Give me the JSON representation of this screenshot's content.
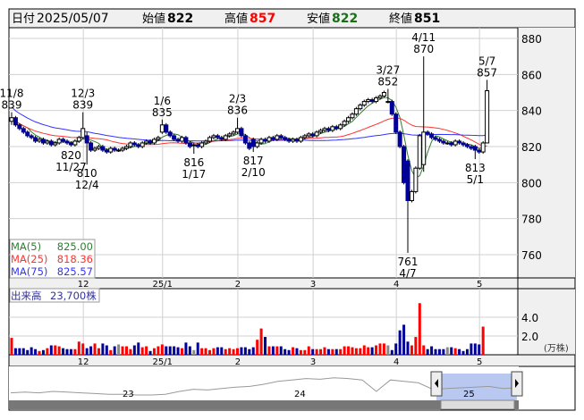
{
  "header": {
    "date_label": "日付",
    "date": "2025/05/07",
    "open_label": "始値",
    "open": "822",
    "high_label": "高値",
    "high": "857",
    "low_label": "安値",
    "low": "822",
    "close_label": "終値",
    "close": "851"
  },
  "legend": {
    "ma5_label": "MA(5)",
    "ma5": "825.00",
    "ma25_label": "MA(25)",
    "ma25": "818.36",
    "ma75_label": "MA(75)",
    "ma75": "825.57"
  },
  "volume_legend": {
    "label": "出来高",
    "value": "23,700株"
  },
  "colors": {
    "up": "#ff0000",
    "down": "#000099",
    "flat": "#888888",
    "ma5": "#2e7d32",
    "ma25": "#ff3333",
    "ma75": "#3333ff"
  },
  "chart_data": {
    "type": "candlestick",
    "price_axis": {
      "ticks": [
        "880",
        "860",
        "840",
        "820",
        "800",
        "780",
        "760"
      ],
      "ylim": [
        752,
        884
      ]
    },
    "volume_axis": {
      "ticks": [
        "4.0",
        "2.0"
      ],
      "unit": "(万株)",
      "ylim": [
        0,
        6.5
      ]
    },
    "month_labels": [
      {
        "label": "12",
        "index": 19
      },
      {
        "label": "25/1",
        "index": 39
      },
      {
        "label": "2",
        "index": 58
      },
      {
        "label": "3",
        "index": 77
      },
      {
        "label": "4",
        "index": 98
      },
      {
        "label": "5",
        "index": 119
      }
    ],
    "closes": [
      836,
      832,
      830,
      828,
      826,
      825,
      823,
      824,
      822,
      823,
      821,
      822,
      824,
      823,
      822,
      821,
      823,
      825,
      830,
      822,
      818,
      819,
      820,
      818,
      817,
      819,
      818,
      818,
      819,
      820,
      822,
      821,
      820,
      822,
      823,
      822,
      824,
      825,
      832,
      828,
      826,
      824,
      823,
      825,
      822,
      820,
      821,
      820,
      822,
      823,
      825,
      826,
      825,
      824,
      826,
      827,
      828,
      830,
      826,
      822,
      819,
      820,
      822,
      824,
      823,
      825,
      824,
      826,
      825,
      824,
      823,
      824,
      823,
      825,
      826,
      827,
      826,
      828,
      829,
      830,
      829,
      831,
      830,
      832,
      834,
      836,
      838,
      841,
      843,
      845,
      846,
      845,
      847,
      848,
      850,
      845,
      838,
      828,
      820,
      800,
      790,
      795,
      808,
      826,
      828,
      827,
      825,
      824,
      823,
      822,
      822,
      821,
      823,
      822,
      821,
      820,
      819,
      818,
      817,
      822,
      851
    ],
    "overrides": [
      {
        "index": 0,
        "open": 834,
        "high": 839,
        "low": 832
      },
      {
        "index": 18,
        "open": 825,
        "high": 839,
        "low": 824
      },
      {
        "index": 19,
        "open": 826,
        "high": 828,
        "low": 810
      },
      {
        "index": 38,
        "open": 828,
        "high": 835,
        "low": 827
      },
      {
        "index": 46,
        "open": 821,
        "high": 822,
        "low": 816
      },
      {
        "index": 57,
        "open": 828,
        "high": 836,
        "low": 827
      },
      {
        "index": 61,
        "open": 824,
        "high": 825,
        "low": 817
      },
      {
        "index": 95,
        "open": 845,
        "high": 852,
        "low": 844
      },
      {
        "index": 100,
        "open": 812,
        "high": 813,
        "low": 761
      },
      {
        "index": 104,
        "open": 810,
        "high": 870,
        "low": 806
      },
      {
        "index": 117,
        "open": 820,
        "high": 821,
        "low": 813
      },
      {
        "index": 120,
        "open": 822,
        "high": 857,
        "low": 822
      }
    ],
    "annotations": [
      {
        "date": "11/8",
        "value": "839",
        "index": 0,
        "pos": "above"
      },
      {
        "date": "12/3",
        "value": "839",
        "index": 18,
        "pos": "above"
      },
      {
        "date": "11/27",
        "value": "820",
        "index": 15,
        "pos": "below"
      },
      {
        "date": "12/4",
        "value": "810",
        "index": 19,
        "pos": "below"
      },
      {
        "date": "1/6",
        "value": "835",
        "index": 38,
        "pos": "above"
      },
      {
        "date": "1/17",
        "value": "816",
        "index": 46,
        "pos": "below"
      },
      {
        "date": "2/3",
        "value": "836",
        "index": 57,
        "pos": "above"
      },
      {
        "date": "2/10",
        "value": "817",
        "index": 61,
        "pos": "below"
      },
      {
        "date": "3/27",
        "value": "852",
        "index": 95,
        "pos": "above"
      },
      {
        "date": "4/7",
        "value": "761",
        "index": 100,
        "pos": "below"
      },
      {
        "date": "4/11",
        "value": "870",
        "index": 104,
        "pos": "above"
      },
      {
        "date": "5/1",
        "value": "813",
        "index": 117,
        "pos": "below"
      },
      {
        "date": "5/7",
        "value": "857",
        "index": 120,
        "pos": "above"
      }
    ],
    "volumes": [
      1.8,
      0.7,
      0.7,
      0.7,
      0.5,
      0.8,
      0.6,
      0.4,
      0.5,
      0.7,
      1.0,
      1.0,
      0.9,
      0.7,
      0.6,
      0.6,
      0.6,
      1.4,
      1.2,
      0.7,
      0.9,
      1.2,
      0.7,
      1.2,
      1.0,
      0.5,
      0.9,
      1.1,
      0.9,
      0.9,
      0.6,
      1.0,
      1.3,
      0.8,
      0.9,
      0.4,
      0.7,
      0.9,
      1.1,
      0.9,
      0.9,
      0.9,
      0.8,
      0.7,
      1.3,
      0.9,
      0.5,
      1.3,
      0.7,
      0.7,
      0.5,
      0.7,
      0.8,
      0.8,
      0.6,
      0.7,
      0.6,
      0.7,
      0.8,
      0.8,
      0.6,
      0.8,
      1.6,
      2.8,
      1.9,
      0.9,
      0.9,
      0.9,
      0.9,
      0.6,
      0.5,
      0.8,
      0.7,
      0.5,
      0.5,
      0.9,
      0.6,
      0.6,
      0.6,
      0.8,
      0.6,
      0.6,
      0.6,
      0.6,
      0.9,
      0.9,
      0.8,
      0.7,
      0.7,
      1.0,
      0.8,
      0.8,
      1.0,
      1.2,
      1.2,
      1.0,
      0.5,
      1.2,
      2.6,
      3.2,
      1.4,
      1.0,
      1.9,
      5.5,
      1.0,
      0.6,
      0.9,
      0.6,
      0.6,
      0.6,
      0.8,
      0.8,
      0.7,
      0.6,
      0.4,
      0.6,
      1.2,
      1.2,
      1.1,
      3.0
    ],
    "navigator": [
      820,
      821,
      820,
      822,
      821,
      820,
      819,
      818,
      818,
      817,
      817,
      818,
      822,
      825,
      824,
      826,
      828,
      829,
      832,
      836,
      838,
      840,
      839,
      841,
      840,
      838,
      822,
      838,
      836,
      834,
      825,
      826,
      827,
      828,
      829,
      826,
      827
    ]
  },
  "navigator_labels": [
    "23",
    "24",
    "25"
  ]
}
